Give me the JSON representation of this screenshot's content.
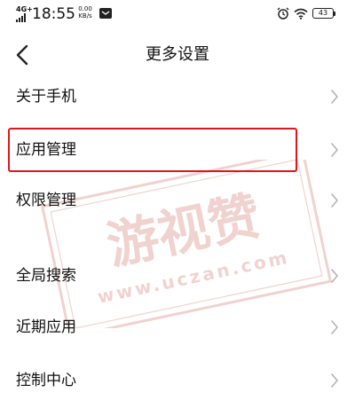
{
  "status_bar": {
    "network": "4G+",
    "time": "18:55",
    "speed_value": "0.00",
    "speed_unit": "KB/s",
    "battery": "43"
  },
  "header": {
    "title": "更多设置"
  },
  "settings": {
    "items": [
      {
        "label": "关于手机"
      },
      {
        "label": "应用管理",
        "highlighted": true
      },
      {
        "label": "权限管理"
      },
      {
        "label": "全局搜索"
      },
      {
        "label": "近期应用"
      },
      {
        "label": "控制中心"
      }
    ]
  },
  "watermark": {
    "brand": "游视赞",
    "url": "www.uczan.com"
  },
  "colors": {
    "highlight_border": "#e0161b",
    "chevron": "#b3b3b3",
    "watermark": "#c0392b"
  },
  "icons": [
    "signal-icon",
    "message-icon",
    "alarm-icon",
    "wifi-icon",
    "battery-icon",
    "back-arrow-icon",
    "chevron-right-icon"
  ]
}
